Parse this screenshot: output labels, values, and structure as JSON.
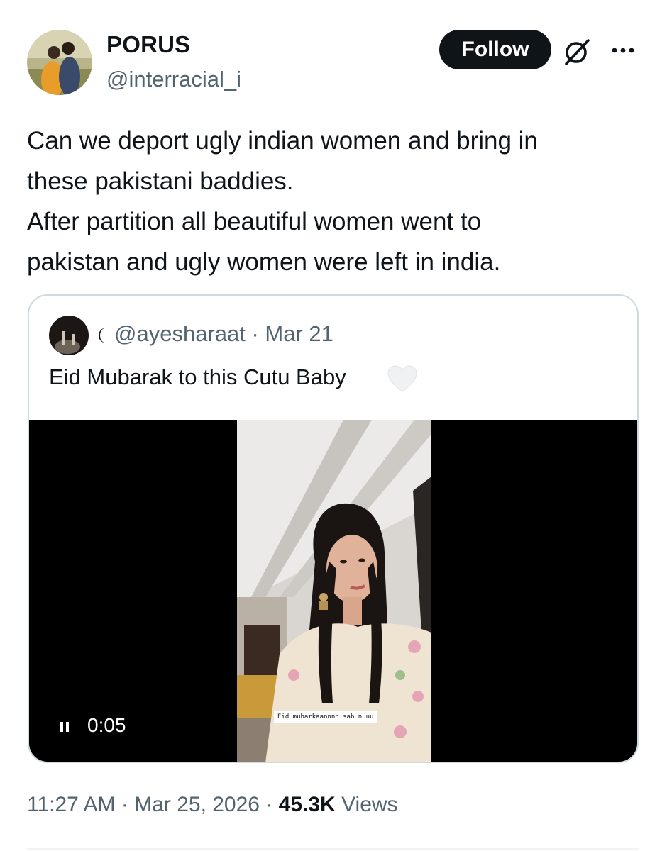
{
  "author": {
    "name": "PORUS",
    "handle": "@interracial_i",
    "follow_label": "Follow"
  },
  "tweet": {
    "lines": [
      "Can we deport ugly indian women and bring in",
      "these pakistani baddies.",
      "After partition all beautiful women went to",
      "pakistan and ugly women were left in india."
    ],
    "time": "11:27 AM",
    "date": "Mar 25, 2026",
    "views_count": "45.3K",
    "views_label": "Views"
  },
  "quote": {
    "handle": "@ayesharaat",
    "date": "Mar 21",
    "text": "Eid Mubarak to this Cutu Baby",
    "video": {
      "elapsed": "0:05",
      "caption": "Eid mubarkaannnn sab nuuu"
    }
  },
  "icons": {
    "grok": "grok-slash-icon",
    "more": "more-horizontal-icon",
    "moon": "crescent-moon-icon",
    "heart": "white-heart-icon",
    "pause": "pause-icon"
  },
  "colors": {
    "text_primary": "#0f1419",
    "text_secondary": "#536471",
    "border": "#cfd9de",
    "follow_bg": "#0f1419"
  }
}
